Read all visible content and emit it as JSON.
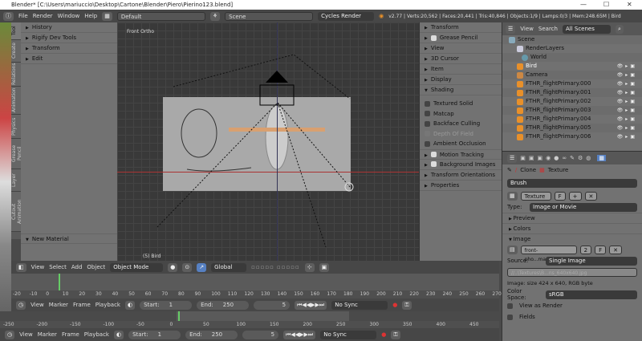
{
  "title": "Blender* [C:\\Users\\mariuccio\\Desktop\\Cartone\\Blender\\Piero\\Pierino123.blend]",
  "info": {
    "menus": [
      "File",
      "Render",
      "Window",
      "Help"
    ],
    "layout": "Default",
    "scene": "Scene",
    "engine": "Cycles Render",
    "stats": "v2.77 | Verts:20,562 | Faces:20,441 | Tris:40,846 | Objects:1/9 | Lamps:0/3 | Mem:248.65M | Bird"
  },
  "tool_tabs": [
    "Tool",
    "Create",
    "Relations",
    "Animation",
    "Physics",
    "Grease Pencil",
    "Layer",
    "Cutout Animation"
  ],
  "tool_panels": [
    "History",
    "Rigify Dev Tools",
    "Transform",
    "Edit"
  ],
  "new_material": "New Material",
  "viewport": {
    "view_name": "Front Ortho",
    "object_label": "(5) Bird"
  },
  "npanel": {
    "sections_top": [
      "Transform",
      "Grease Pencil",
      "View",
      "3D Cursor",
      "Item",
      "Display",
      "Shading"
    ],
    "shading_options": [
      "Textured Solid",
      "Matcap",
      "Backface Culling",
      "Depth Of Field",
      "Ambient Occlusion"
    ],
    "sections_bottom": [
      "Motion Tracking",
      "Background Images",
      "Transform Orientations",
      "Properties"
    ]
  },
  "outliner": {
    "view": "View",
    "search": "Search",
    "filter": "All Scenes",
    "rows": [
      "Scene",
      "RenderLayers",
      "World",
      "Bird",
      "Camera",
      "FTHR_flightPrimary.000",
      "FTHR_flightPrimary.001",
      "FTHR_flightPrimary.002",
      "FTHR_flightPrimary.003",
      "FTHR_flightPrimary.004",
      "FTHR_flightPrimary.005",
      "FTHR_flightPrimary.006"
    ]
  },
  "properties": {
    "clone": "Clone",
    "texture_tab": "Texture",
    "brush": "Brush",
    "texture_name": "Texture",
    "f": "F",
    "type_label": "Type:",
    "type_value": "Image or Movie",
    "preview": "Preview",
    "colors": "Colors",
    "image": "Image",
    "image_name": "front-pho...madzona",
    "users": "2",
    "source_label": "Source:",
    "source_value": "Single Image",
    "path": "//..\\Textures\\B...ns_640x640.jpg",
    "image_info": "Image: size 424 x 640, RGB byte",
    "colorspace_label": "Color Space:",
    "colorspace_value": "sRGB",
    "view_as_render": "View as Render",
    "fields": "Fields"
  },
  "header3d": {
    "menus": [
      "View",
      "Select",
      "Add",
      "Object"
    ],
    "mode": "Object Mode",
    "orientation": "Global"
  },
  "timeline": {
    "menus": [
      "View",
      "Marker",
      "Frame",
      "Playback"
    ],
    "start_label": "Start:",
    "start": "1",
    "end_label": "End:",
    "end": "250",
    "current": "5",
    "sync": "No Sync",
    "ruler1": [
      "-20",
      "-10",
      "0",
      "10",
      "20",
      "30",
      "40",
      "50",
      "60",
      "70",
      "80",
      "90",
      "100",
      "110",
      "120",
      "130",
      "140",
      "150",
      "160",
      "170",
      "180",
      "190",
      "200",
      "210",
      "220",
      "230",
      "240",
      "250",
      "260",
      "270"
    ],
    "ruler2": [
      "-250",
      "-200",
      "-150",
      "-100",
      "-50",
      "0",
      "50",
      "100",
      "150",
      "200",
      "250",
      "300",
      "350",
      "400",
      "450"
    ]
  }
}
